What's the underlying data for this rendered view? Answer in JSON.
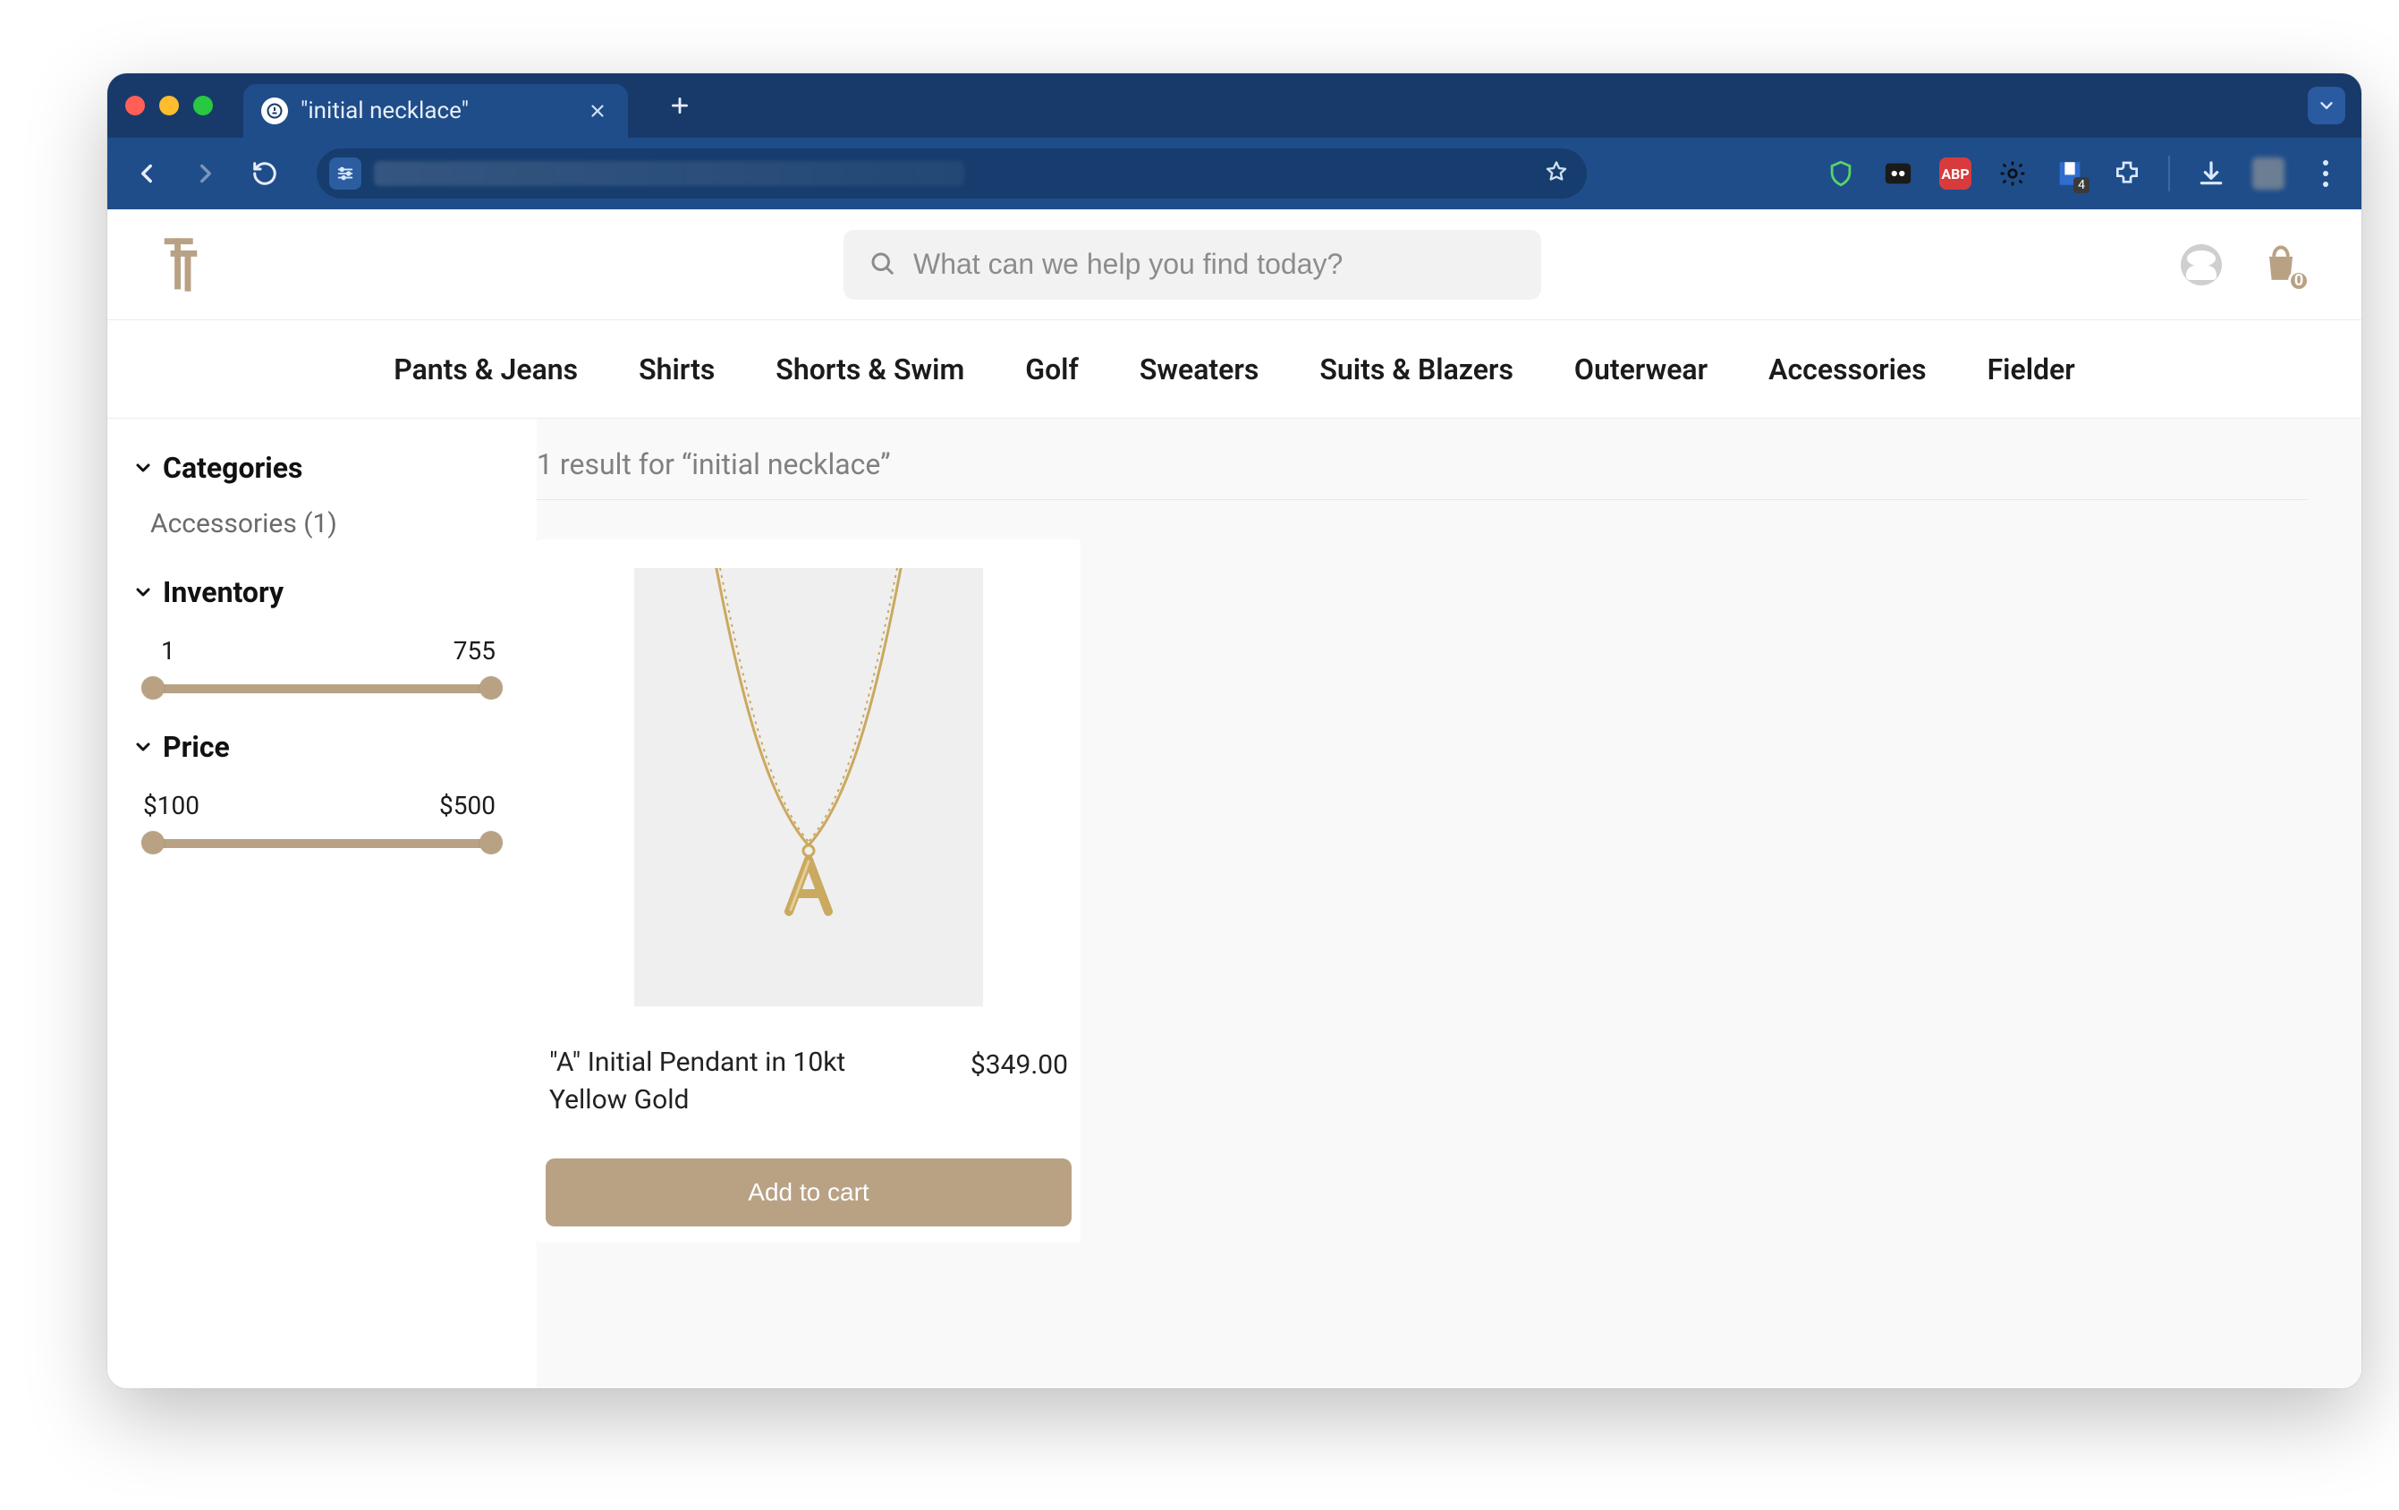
{
  "browser": {
    "tab_title": "\"initial necklace\"",
    "ext_badge": "4",
    "abp_label": "ABP"
  },
  "header": {
    "search_placeholder": "What can we help you find today?",
    "cart_badge": "0"
  },
  "nav": {
    "items": [
      "Pants & Jeans",
      "Shirts",
      "Shorts & Swim",
      "Golf",
      "Sweaters",
      "Suits & Blazers",
      "Outerwear",
      "Accessories",
      "Fielder"
    ]
  },
  "sidebar": {
    "categories": {
      "title": "Categories",
      "items": [
        "Accessories (1)"
      ]
    },
    "inventory": {
      "title": "Inventory",
      "min": "1",
      "max": "755"
    },
    "price": {
      "title": "Price",
      "min": "$100",
      "max": "$500"
    }
  },
  "results": {
    "heading": "1 result for “initial necklace”",
    "products": [
      {
        "title": "\"A\" Initial Pendant in 10kt Yellow Gold",
        "price": "$349.00",
        "cta": "Add to cart"
      }
    ]
  },
  "colors": {
    "accent": "#b9a184",
    "chrome_dark": "#183a6a",
    "chrome_mid": "#1f4d8a"
  }
}
